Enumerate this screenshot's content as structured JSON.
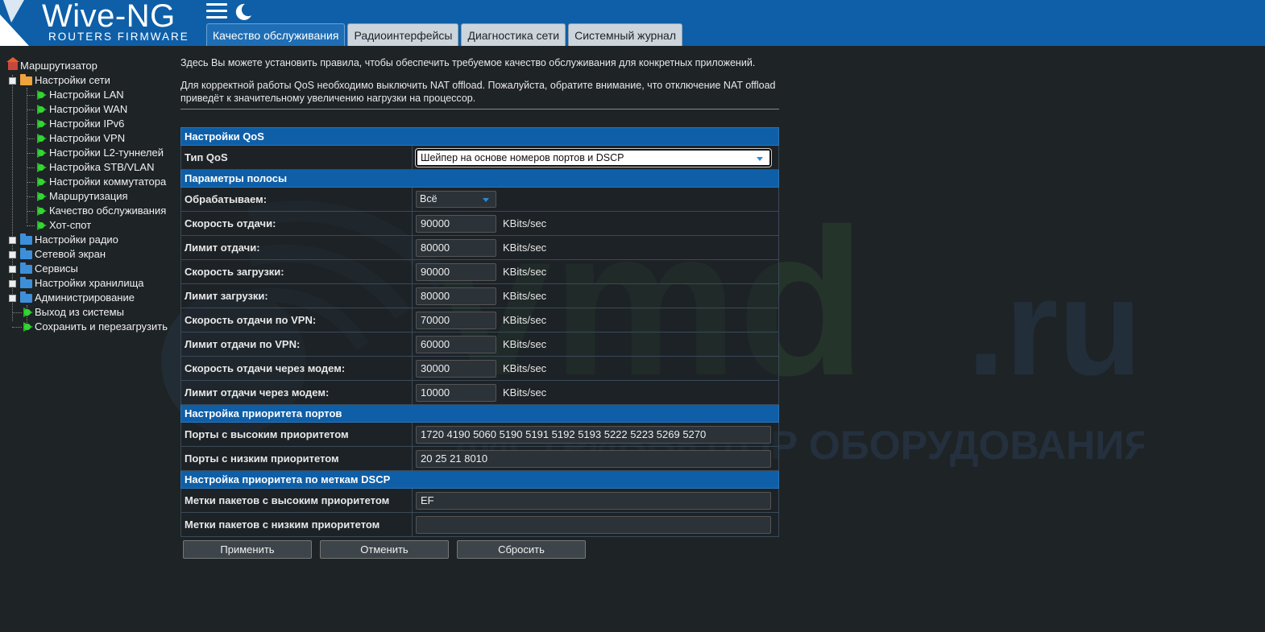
{
  "header": {
    "logo_title": "Wive-NG",
    "logo_subtitle": "ROUTERS FIRMWARE",
    "tabs": [
      {
        "label": "Качество обслуживания",
        "active": true
      },
      {
        "label": "Радиоинтерфейсы",
        "active": false
      },
      {
        "label": "Диагностика сети",
        "active": false
      },
      {
        "label": "Системный журнал",
        "active": false
      }
    ]
  },
  "sidebar": {
    "root": "Маршрутизатор",
    "network": {
      "label": "Настройки сети",
      "items": [
        "Настройки LAN",
        "Настройки WAN",
        "Настройки IPv6",
        "Настройки VPN",
        "Настройки L2-туннелей",
        "Настройка STB/VLAN",
        "Настройки коммутатора",
        "Маршрутизация",
        "Качество обслуживания",
        "Хот-спот"
      ]
    },
    "folders": [
      "Настройки радио",
      "Сетевой экран",
      "Сервисы",
      "Настройки хранилища",
      "Администрирование"
    ],
    "admin_items": [
      "Выход из системы",
      "Сохранить и перезагрузить"
    ]
  },
  "intro": {
    "line1": "Здесь Вы можете установить правила, чтобы обеспечить требуемое качество обслуживания для конкретных приложений.",
    "line2": "Для корректной работы QoS необходимо выключить NAT offload. Пожалуйста, обратите внимание, что отключение NAT offload приведёт к значительному увеличению нагрузки на процессор."
  },
  "qos": {
    "section_title": "Настройки QoS",
    "type_label": "Тип QoS",
    "type_value": "Шейпер на основе номеров портов и DSCP"
  },
  "bandwidth": {
    "section_title": "Параметры полосы",
    "process_label": "Обрабатываем:",
    "process_value": "Всё",
    "unit": "KBits/sec",
    "rows": [
      {
        "label": "Скорость отдачи:",
        "value": "90000"
      },
      {
        "label": "Лимит отдачи:",
        "value": "80000"
      },
      {
        "label": "Скорость загрузки:",
        "value": "90000"
      },
      {
        "label": "Лимит загрузки:",
        "value": "80000"
      },
      {
        "label": "Скорость отдачи по VPN:",
        "value": "70000"
      },
      {
        "label": "Лимит отдачи по VPN:",
        "value": "60000"
      },
      {
        "label": "Скорость отдачи через модем:",
        "value": "30000"
      },
      {
        "label": "Лимит отдачи через модем:",
        "value": "10000"
      }
    ]
  },
  "ports": {
    "section_title": "Настройка приоритета портов",
    "high_label": "Порты с высоким приоритетом",
    "high_value": "1720 4190 5060 5190 5191 5192 5193 5222 5223 5269 5270",
    "low_label": "Порты с низким приоритетом",
    "low_value": "20 25 21 8010"
  },
  "dscp": {
    "section_title": "Настройка приоритета по меткам DSCP",
    "high_label": "Метки пакетов с высоким приоритетом",
    "high_value": "EF",
    "low_label": "Метки пакетов с низким приоритетом",
    "low_value": ""
  },
  "buttons": {
    "apply": "Применить",
    "cancel": "Отменить",
    "reset": "Сбросить"
  },
  "watermark": {
    "brand": "vmd.ru",
    "tagline": "ДИСТРИБЬЮТОР ОБОРУДОВАНИЯ СВЯЗИ"
  },
  "colors": {
    "header_blue": "#0e5fa8",
    "background": "#1e2326",
    "leaf_green": "#1bb81b"
  }
}
